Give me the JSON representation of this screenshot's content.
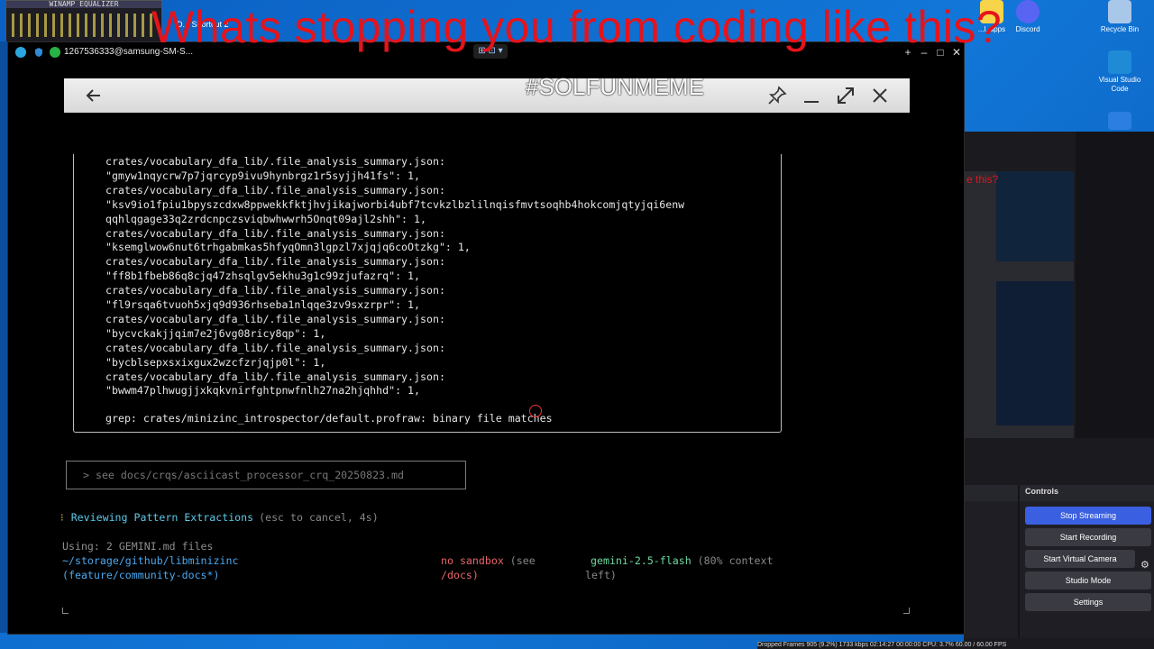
{
  "headline": "Whats stopping you from coding like this?",
  "desktop": {
    "winamp_title": "WINAMP EQUALIZER",
    "shortcut_label": "D... Shortcut 2",
    "icons": [
      {
        "name": "vlc-apps",
        "label": "...l..apps"
      },
      {
        "name": "discord",
        "label": "Discord"
      },
      {
        "name": "recycle-bin",
        "label": "Recycle Bin"
      },
      {
        "name": "vscode",
        "label": "Visual Studio Code"
      }
    ]
  },
  "scrcpy": {
    "window_title": "1267536333@samsung-SM-S..."
  },
  "appbar": {
    "title": "#SOLFUNMEME"
  },
  "terminal": {
    "output_lines": [
      "crates/vocabulary_dfa_lib/.file_analysis_summary.json:",
      "\"gmyw1nqycrw7p7jqrcyp9ivu9hynbrgz1r5syjjh41fs\": 1,",
      "crates/vocabulary_dfa_lib/.file_analysis_summary.json:",
      "\"ksv9io1fpiu1bpyszcdxw8ppwekkfktjhvjikajworbi4ubf7tcvkzlbzlilnqisfmvtsoqhb4hokcomjqtyjqi6enw",
      "qqhlqgage33q2zrdcnpczsviqbwhwwrh5Onqt09ajl2shh\": 1,",
      "crates/vocabulary_dfa_lib/.file_analysis_summary.json:",
      "\"ksemglwow6nut6trhgabmkas5hfyqOmn3lgpzl7xjqjq6coOtzkg\": 1,",
      "crates/vocabulary_dfa_lib/.file_analysis_summary.json:",
      "\"ff8b1fbeb86q8cjq47zhsqlgv5ekhu3g1c99zjufazrq\": 1,",
      "crates/vocabulary_dfa_lib/.file_analysis_summary.json:",
      "\"fl9rsqa6tvuoh5xjq9d936rhseba1nlqqe3zv9sxzrpr\": 1,",
      "crates/vocabulary_dfa_lib/.file_analysis_summary.json:",
      "\"bycvckakjjqim7e2j6vg08ricy8qp\": 1,",
      "crates/vocabulary_dfa_lib/.file_analysis_summary.json:",
      "\"bycblsepxsxixgux2wzcfzrjqjp0l\": 1,",
      "crates/vocabulary_dfa_lib/.file_analysis_summary.json:",
      "\"bwwm47plhwugjjxkqkvnirfghtpnwfnlh27na2hjqhhd\": 1,"
    ],
    "grep_line": "grep: crates/minizinc_introspector/default.profraw: binary file matches",
    "command_text": "> see docs/crqs/asciicast_processor_crq_20250823.md",
    "spinner": "⁝",
    "reviewing": "Reviewing Pattern Extractions",
    "reviewing_hint": "(esc to cancel, 4s)",
    "using": "Using: 2 GEMINI.md files",
    "path": "~/storage/github/libminizinc",
    "branch": "(feature/community-docs*)",
    "sandbox": "no sandbox",
    "sandbox_see": "(see",
    "sandbox_docs": "/docs)",
    "model": "gemini-2.5-flash",
    "context": "(80% context",
    "context_left": "left)"
  },
  "obs": {
    "controls_title": "Controls",
    "buttons": [
      "Stop Streaming",
      "Start Recording",
      "Start Virtual Camera",
      "Studio Mode",
      "Settings"
    ],
    "status": "Dropped Frames 905 (9.2%)   1733 kbps   02:14:27   00:00:00   CPU: 3.7%   60.00 / 60.00 FPS",
    "mini_text": "e this?"
  },
  "colors": {
    "headline": "#e6131b",
    "accent_blue": "#3a5fe0",
    "terminal_bg": "#000000"
  }
}
